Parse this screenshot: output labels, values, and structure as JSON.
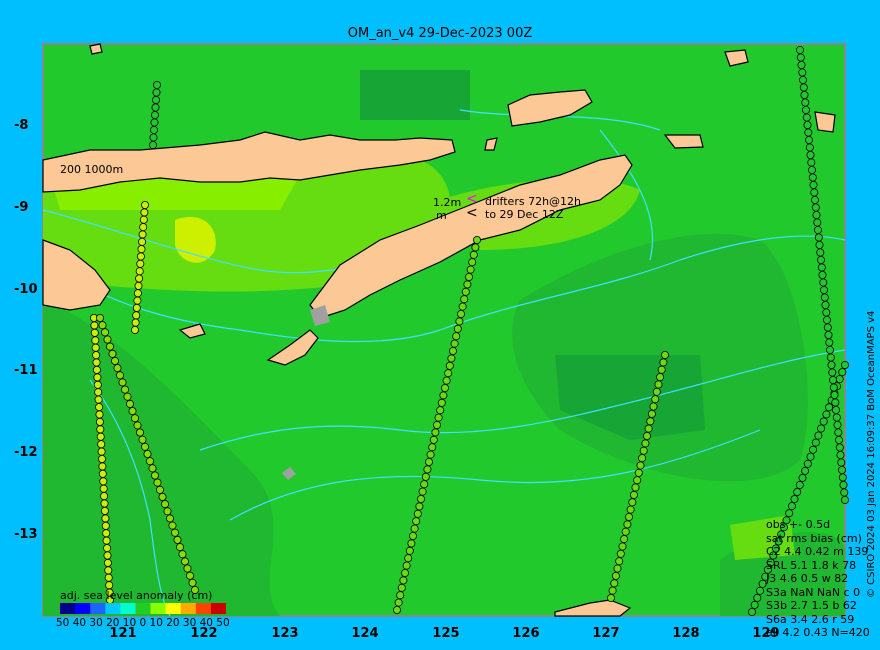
{
  "title": "OM_an_v4  29-Dec-2023 00Z",
  "y_ticks": [
    "-8",
    "-9",
    "-10",
    "-11",
    "-12",
    "-13"
  ],
  "x_ticks": [
    "121",
    "122",
    "123",
    "124",
    "125",
    "126",
    "127",
    "128",
    "129"
  ],
  "credit": "© CSIRO 2024    03 Jan 2024 16:09:37 BoM OceanMAPS v4",
  "contour_label": "200  1000m",
  "scale_label_line1": "1.2m",
  "scale_label_line2": "m",
  "drifters_line1": "drifters 72h@12h",
  "drifters_line2": "to 29 Dec 12Z",
  "drifter_symbol_magenta": "<",
  "drifter_symbol_black": "<",
  "colorbar": {
    "title": "adj. sea level anomaly (cm)",
    "ticks": "50 40 30 20 10  0   10 20 30 40 50",
    "colors": [
      "#00008b",
      "#0000ff",
      "#1e64ff",
      "#00c8ff",
      "#00ffcc",
      "#22cc22",
      "#88ff00",
      "#ffff00",
      "#ffaa00",
      "#ff4400",
      "#cc0000"
    ]
  },
  "stats": {
    "line1": "obs +- 0.5d",
    "line2": "sat rms bias (cm)",
    "rows": [
      "C2    4.4   0.42 m 139",
      "SRL   5.1   1.8 k 78",
      "J3    4.6   0.5 w 82",
      "S3a   NaN  NaN c 0",
      "S3b   2.7  1.5 b 62",
      "S6a   3.4  2.6 r 59",
      "all   4.2   0.43 N=420"
    ]
  },
  "colors": {
    "background": "#00bfff",
    "ocean": "#22c92c",
    "land": "#fcc896",
    "shelf": "#a0a0a0",
    "contour": "#40e0ff"
  }
}
